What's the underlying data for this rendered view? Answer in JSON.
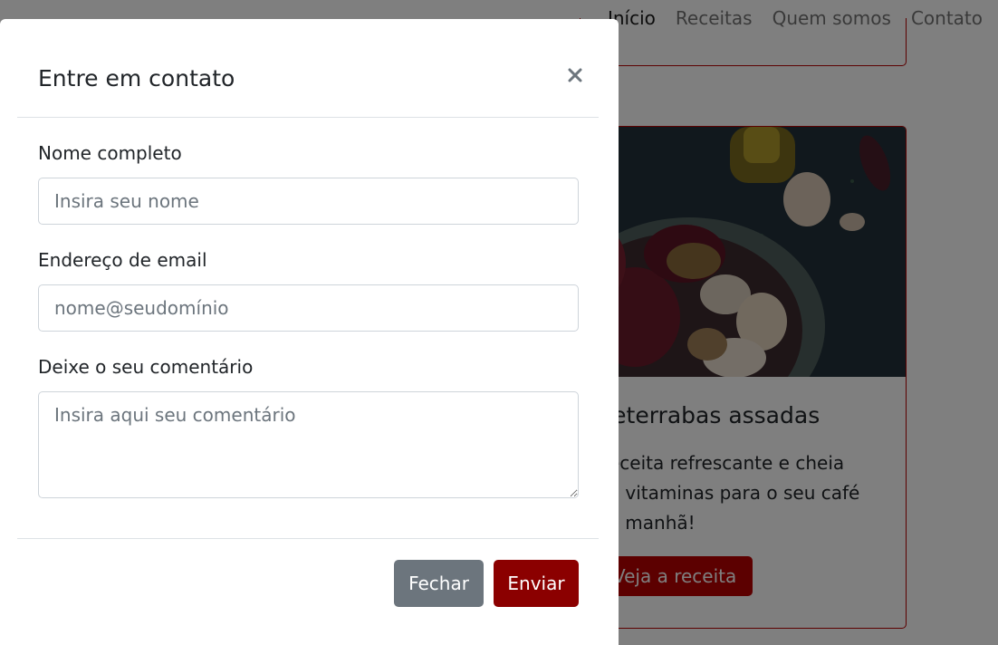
{
  "nav": {
    "items": [
      {
        "label": "Início",
        "active": true
      },
      {
        "label": "Receitas",
        "active": false
      },
      {
        "label": "Quem somos",
        "active": false
      },
      {
        "label": "Contato",
        "active": false
      }
    ]
  },
  "card": {
    "title": "Beterrabas assadas",
    "text": "Receita refrescante e cheia de vitaminas para o seu café da manhã!",
    "button_label": "Veja a receita",
    "image_icon": "roasted-beets-photo"
  },
  "modal": {
    "title": "Entre em contato",
    "close_icon": "close-icon",
    "fields": {
      "name_label": "Nome completo",
      "name_placeholder": "Insira seu nome",
      "email_label": "Endereço de email",
      "email_placeholder": "nome@seudomínio",
      "comment_label": "Deixe o seu comentário",
      "comment_placeholder": "Insira aqui seu comentário"
    },
    "footer": {
      "close_label": "Fechar",
      "send_label": "Enviar"
    }
  },
  "colors": {
    "brand": "#8b0000",
    "card_border": "#b80000",
    "secondary": "#6c757d"
  }
}
